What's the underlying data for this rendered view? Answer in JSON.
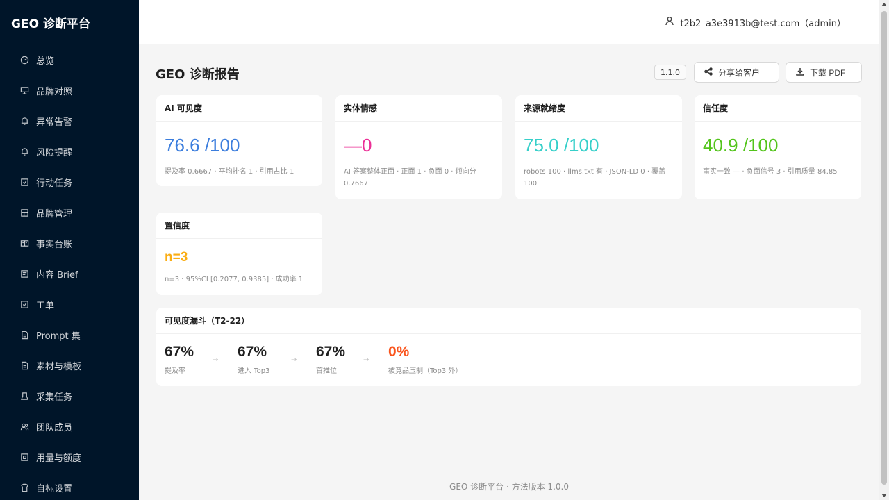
{
  "app": {
    "brand": "GEO 诊断平台"
  },
  "sidebar": {
    "items": [
      {
        "label": "总览",
        "icon": "dashboard-icon"
      },
      {
        "label": "品牌对照",
        "icon": "compare-icon"
      },
      {
        "label": "异常告警",
        "icon": "alert-icon"
      },
      {
        "label": "风险提醒",
        "icon": "risk-icon"
      },
      {
        "label": "行动任务",
        "icon": "task-icon"
      },
      {
        "label": "品牌管理",
        "icon": "brand-icon"
      },
      {
        "label": "事实台账",
        "icon": "ledger-icon"
      },
      {
        "label": "内容 Brief",
        "icon": "brief-icon"
      },
      {
        "label": "工单",
        "icon": "ticket-icon"
      },
      {
        "label": "Prompt 集",
        "icon": "prompt-icon"
      },
      {
        "label": "素材与模板",
        "icon": "template-icon"
      },
      {
        "label": "采集任务",
        "icon": "collect-icon"
      },
      {
        "label": "团队成员",
        "icon": "team-icon"
      },
      {
        "label": "用量与额度",
        "icon": "quota-icon"
      },
      {
        "label": "自标设置",
        "icon": "settings-icon"
      }
    ]
  },
  "header": {
    "user": "t2b2_a3e3913b@test.com（admin）"
  },
  "page": {
    "title": "GEO 诊断报告",
    "version": "1.1.0",
    "share_label": "分享给客户",
    "download_label": "下载 PDF"
  },
  "metrics": [
    {
      "title": "AI 可见度",
      "value": "76.6 /100",
      "detail": "提及率 0.6667 · 平均排名 1 · 引用占比 1",
      "color": "#3b7ddd"
    },
    {
      "title": "实体情感",
      "value": "—0",
      "detail": "AI 答案整体正面 · 正面 1 · 负面 0 · 倾向分 0.7667",
      "color": "#eb2f96"
    },
    {
      "title": "来源就绪度",
      "value": "75.0 /100",
      "detail": "robots 100 · llms.txt 有 · JSON-LD 0 · 覆盖 100",
      "color": "#36cfc9"
    },
    {
      "title": "信任度",
      "value": "40.9 /100",
      "detail": "事实一致 — · 负面信号 3 · 引用质量 84.85",
      "color": "#52c41a"
    }
  ],
  "confidence": {
    "title": "置信度",
    "value": "n=3",
    "detail": "n=3 · 95%CI [0.2077, 0.9385] · 成功率 1",
    "color": "#faad14"
  },
  "funnel": {
    "title": "可见度漏斗（T2-22）",
    "arrow": "→",
    "steps": [
      {
        "pct": "67%",
        "label": "提及率",
        "color": "#1f1f1f"
      },
      {
        "pct": "67%",
        "label": "进入 Top3",
        "color": "#1f1f1f"
      },
      {
        "pct": "67%",
        "label": "首推位",
        "color": "#1f1f1f"
      },
      {
        "pct": "0%",
        "label": "被竞品压制（Top3 外）",
        "color": "#fa541c"
      }
    ]
  },
  "footer": {
    "text": "GEO 诊断平台 · 方法版本 1.0.0"
  }
}
